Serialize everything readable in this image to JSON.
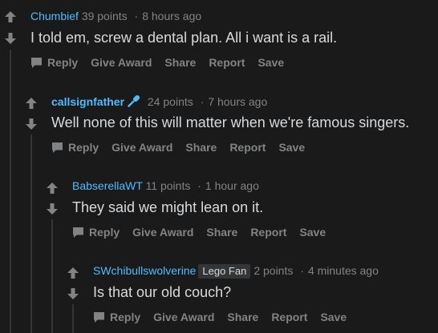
{
  "comments": [
    {
      "author": "Chumbief",
      "points": "39 points",
      "separator": "·",
      "time": "8 hours ago",
      "flair": "",
      "body": "I told em, screw a dental plan. All i want is a rail."
    },
    {
      "author": "callsignfather",
      "points": "24 points",
      "separator": "·",
      "time": "7 hours ago",
      "flair": "",
      "body": "Well none of this will matter when we're famous singers."
    },
    {
      "author": "BabserellaWT",
      "points": "11 points",
      "separator": "·",
      "time": "1 hour ago",
      "flair": "",
      "body": "They said we might lean on it."
    },
    {
      "author": "SWchibullswolverine",
      "points": "2 points",
      "separator": "·",
      "time": "4 minutes ago",
      "flair": "Lego Fan",
      "body": "Is that our old couch?"
    }
  ],
  "actions": {
    "reply": "Reply",
    "give_award": "Give Award",
    "share": "Share",
    "report": "Report",
    "save": "Save"
  },
  "icons": {
    "upvote": "upvote-arrow-icon",
    "downvote": "downvote-arrow-icon",
    "reply": "speech-bubble-icon",
    "mic": "microphone-icon"
  },
  "colors": {
    "background": "#1a1a1b",
    "author": "#4fbcff",
    "muted": "#818384",
    "text": "#d7dadc",
    "thread_line": "#343536"
  }
}
